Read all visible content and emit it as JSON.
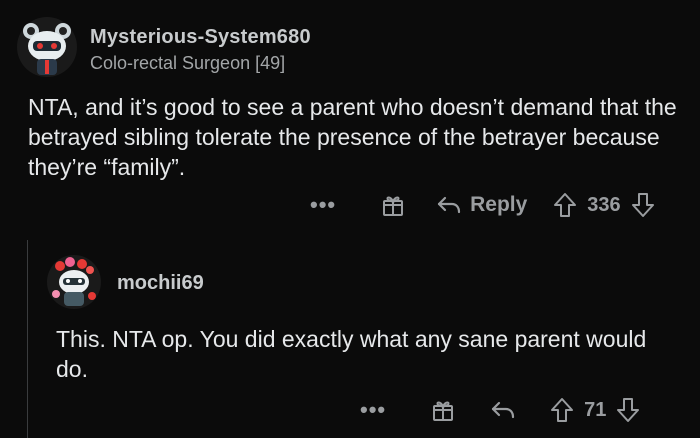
{
  "comments": [
    {
      "username": "Mysterious-System680",
      "flair": "Colo-rectal Surgeon [49]",
      "body": "NTA, and it’s good to see a parent who doesn’t demand that the betrayed sibling tolerate the presence of the betrayer because they’re “family”.",
      "actions": {
        "more_label": "•••",
        "reply_label": "Reply",
        "vote_count": "336"
      }
    },
    {
      "username": "mochii69",
      "body": "This. NTA op. You did exactly what any sane parent would do.",
      "actions": {
        "more_label": "•••",
        "vote_count": "71"
      }
    }
  ],
  "icons": {
    "award": "gift-icon",
    "reply": "reply-arrow-icon",
    "upvote": "upvote-arrow-icon",
    "downvote": "downvote-arrow-icon"
  },
  "colors": {
    "background": "#0b0b0b",
    "text": "#e6e8ea",
    "muted": "#9a9da0"
  }
}
